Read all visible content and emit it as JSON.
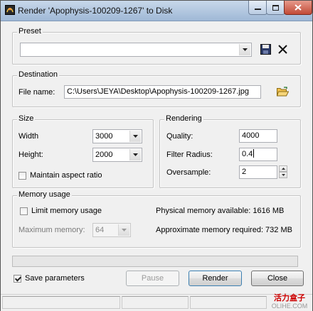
{
  "window": {
    "title": "Render 'Apophysis-100209-1267' to Disk",
    "icon": "render-icon",
    "controls": {
      "minimize": "minimize-icon",
      "maximize": "maximize-icon",
      "close": "close-icon"
    }
  },
  "preset": {
    "legend": "Preset",
    "value": "",
    "save_icon": "floppy-save-icon",
    "delete_icon": "x-delete-icon"
  },
  "destination": {
    "legend": "Destination",
    "file_name_label": "File name:",
    "file_name_value": "C:\\Users\\JEYA\\Desktop\\Apophysis-100209-1267.jpg",
    "browse_icon": "open-folder-icon"
  },
  "size": {
    "legend": "Size",
    "width_label": "Width",
    "width_value": "3000",
    "height_label": "Height:",
    "height_value": "2000",
    "aspect_label": "Maintain aspect ratio",
    "aspect_checked": false
  },
  "rendering": {
    "legend": "Rendering",
    "quality_label": "Quality:",
    "quality_value": "4000",
    "filter_label": "Filter Radius:",
    "filter_value": "0.4",
    "oversample_label": "Oversample:",
    "oversample_value": "2"
  },
  "memory": {
    "legend": "Memory usage",
    "limit_label": "Limit memory usage",
    "limit_checked": false,
    "max_label": "Maximum memory:",
    "max_value": "64",
    "physical_label": "Physical memory available: 1616 MB",
    "approx_label": "Approximate memory required: 732 MB"
  },
  "progress": {
    "value": 0
  },
  "footer": {
    "save_params_label": "Save parameters",
    "save_params_checked": true,
    "pause_label": "Pause",
    "render_label": "Render",
    "close_label": "Close"
  },
  "watermark": {
    "text": "活力盒子",
    "sub": "OLIHE.COM"
  },
  "colors": {
    "title_gradient_top": "#c8d8ea",
    "close_button": "#c24a36",
    "background": "#f0f0f0"
  }
}
